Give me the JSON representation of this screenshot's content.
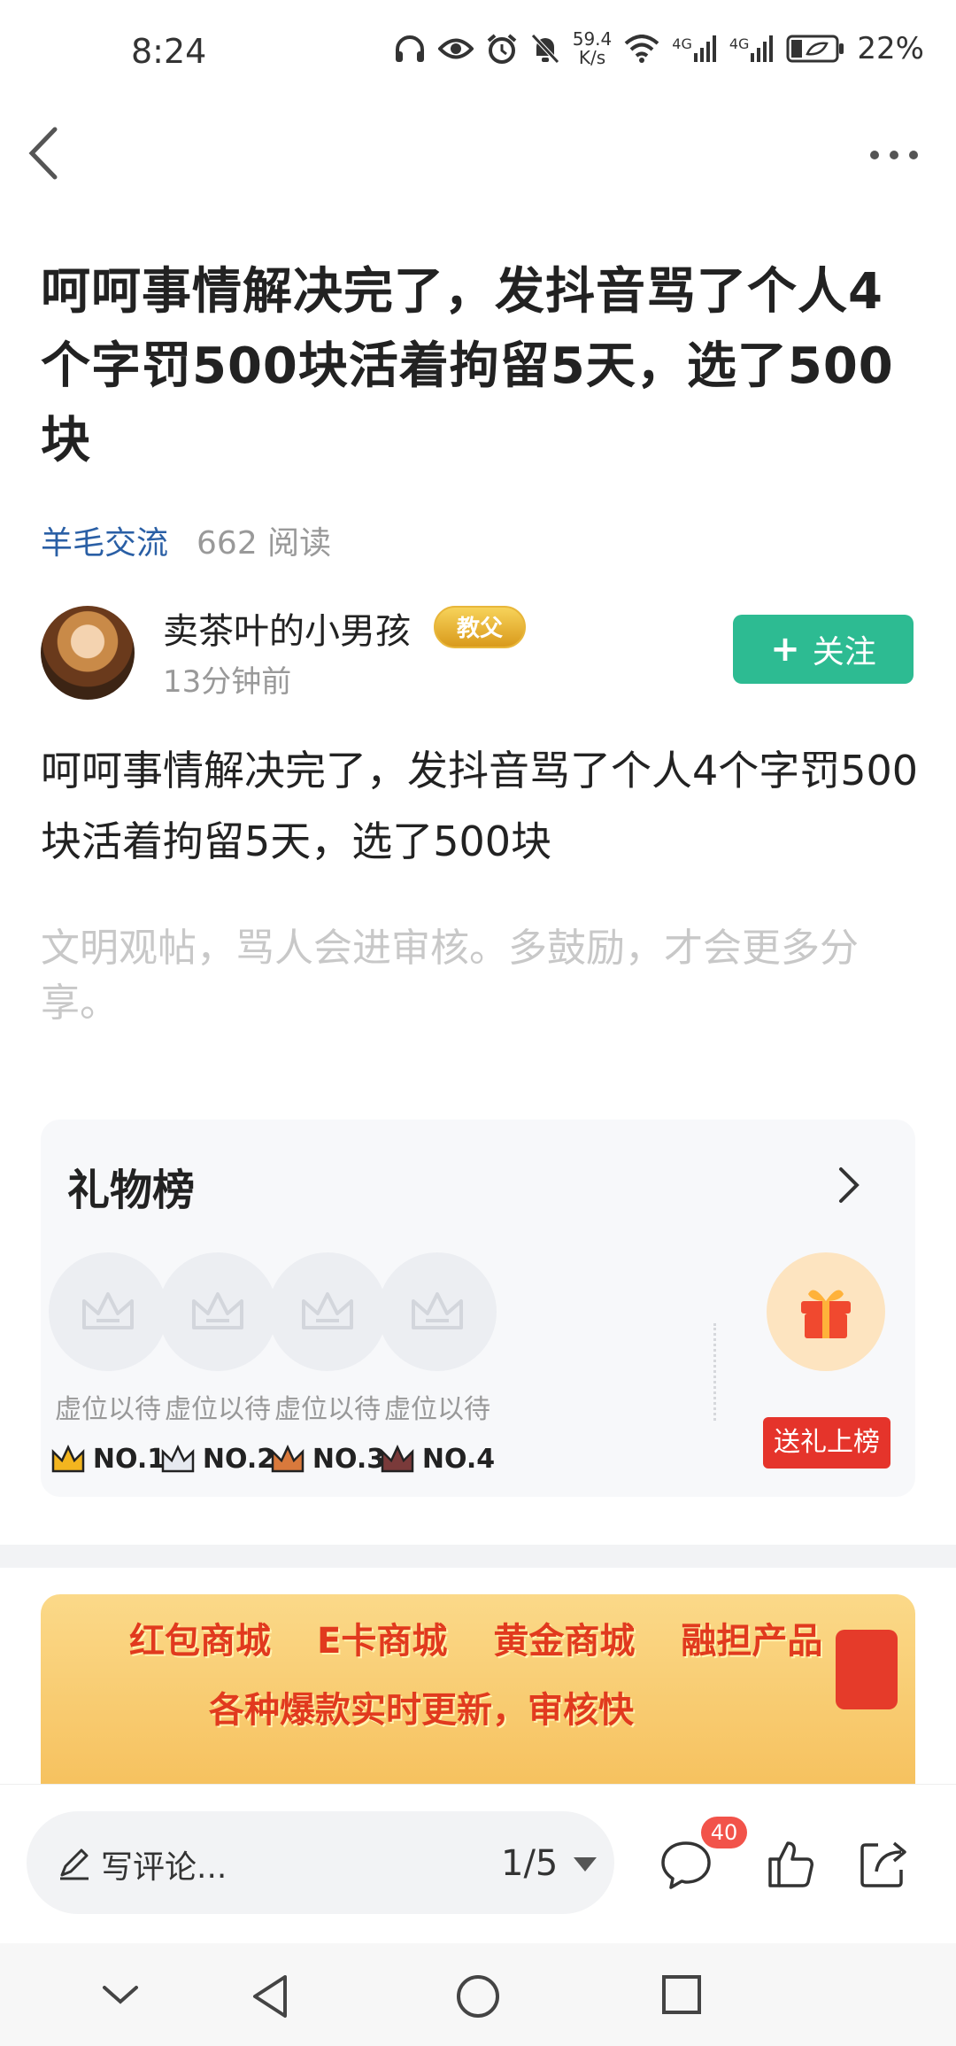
{
  "status_bar": {
    "time": "8:24",
    "net_speed_value": "59.4",
    "net_speed_unit": "K/s",
    "sim1": "4G",
    "sim2": "4G",
    "battery": "22%"
  },
  "article": {
    "title": "呵呵事情解决完了，发抖音骂了个人4个字罚500块活着拘留5天，选了500块",
    "category": "羊毛交流",
    "reads": "662 阅读",
    "body": "呵呵事情解决完了，发抖音骂了个人4个字罚500块活着拘留5天，选了500块",
    "civility_hint": "文明观帖，骂人会进审核。多鼓励，才会更多分享。"
  },
  "author": {
    "name": "卖茶叶的小男孩",
    "badge": "教父",
    "time": "13分钟前",
    "follow_label": "关注"
  },
  "gift_board": {
    "title": "礼物榜",
    "slots": [
      {
        "label": "虚位以待",
        "rank": "NO.1",
        "crown_color": "#f3b51f"
      },
      {
        "label": "虚位以待",
        "rank": "NO.2",
        "crown_color": "#9aa3b5"
      },
      {
        "label": "虚位以待",
        "rank": "NO.3",
        "crown_color": "#d9793c"
      },
      {
        "label": "虚位以待",
        "rank": "NO.4",
        "crown_color": "#7a3a3a"
      }
    ],
    "send_label": "送礼上榜"
  },
  "banner": {
    "items": [
      "红包商城",
      "E卡商城",
      "黄金商城",
      "融担产品"
    ],
    "slogan": "各种爆款实时更新，审核快"
  },
  "bottom_bar": {
    "comment_placeholder": "写评论...",
    "page": "1/5",
    "comment_count": "40"
  },
  "colors": {
    "accent_green": "#2dbb92",
    "category_blue": "#2a5fa5",
    "red": "#e5342b"
  }
}
